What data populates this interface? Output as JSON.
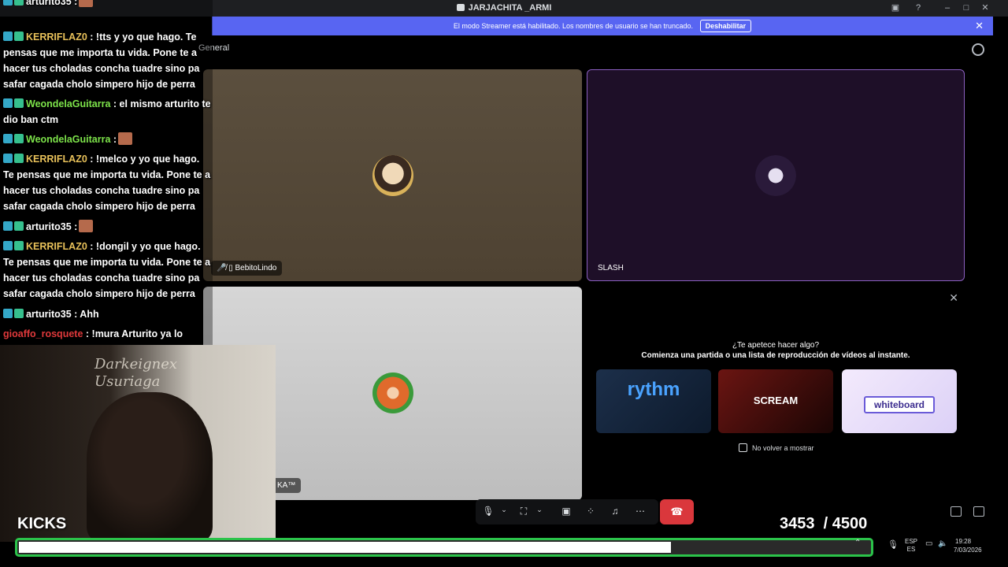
{
  "window": {
    "title": "JARJACHITA _ARMI"
  },
  "banner": {
    "text": "El modo Streamer está habilitado. Los nombres de usuario se han truncado.",
    "button": "Deshabilitar"
  },
  "channel": {
    "name": "General"
  },
  "participants": [
    {
      "name": "BebitoLindo"
    },
    {
      "name": "SLASH"
    },
    {
      "name": "KA™"
    }
  ],
  "activity": {
    "question": "¿Te apetece hacer algo?",
    "subtitle": "Comienza una partida o una lista de reproducción de vídeos al instante.",
    "cards": [
      "rythm",
      "SCREAM",
      "whiteboard"
    ],
    "checkbox_label": "No volver a mostrar"
  },
  "chat": [
    {
      "user": "KERRIFLAZ0",
      "color": "#e8c15a",
      "text": ": !tts y yo que hago. Te pensas que me importa tu vida. Pone te a hacer tus choladas concha tuadre sino pa safar cagada cholo simpero hijo de perra"
    },
    {
      "user": "WeondelaGuitarra",
      "color": "#7de34a",
      "text": ": el mismo arturito te dio ban ctm"
    },
    {
      "user": "WeondelaGuitarra",
      "color": "#7de34a",
      "text": ":"
    },
    {
      "user": "KERRIFLAZ0",
      "color": "#e8c15a",
      "text": ": !melco y yo que hago. Te pensas que me importa tu vida. Pone te a hacer tus choladas concha tuadre sino pa safar cagada cholo simpero hijo de perra"
    },
    {
      "user": "arturito35",
      "color": "#ffffff",
      "text": ":"
    },
    {
      "user": "KERRIFLAZ0",
      "color": "#e8c15a",
      "text": ": !dongil y yo que hago. Te pensas que me importa tu vida. Pone te a hacer tus choladas concha tuadre sino pa safar cagada cholo simpero hijo de perra"
    },
    {
      "user": "arturito35",
      "color": "#ffffff",
      "text": ": Ahh"
    },
    {
      "user": "gioaffo_rosquete",
      "color": "#e0393b",
      "text": ": !mura Arturito ya lo enfriaron igual que a pollito"
    }
  ],
  "chat_top": {
    "user": "arturito35",
    "text": ":"
  },
  "overlay": {
    "label": "KICKS",
    "count": "3453",
    "goal": "/ 4500",
    "progress": 0.767
  },
  "webcam": {
    "wall_text": "Darkeignex\nUsuriaga"
  },
  "tray": {
    "lang": "ESP\nES",
    "time": "19:28",
    "date": "7/03/2026"
  }
}
